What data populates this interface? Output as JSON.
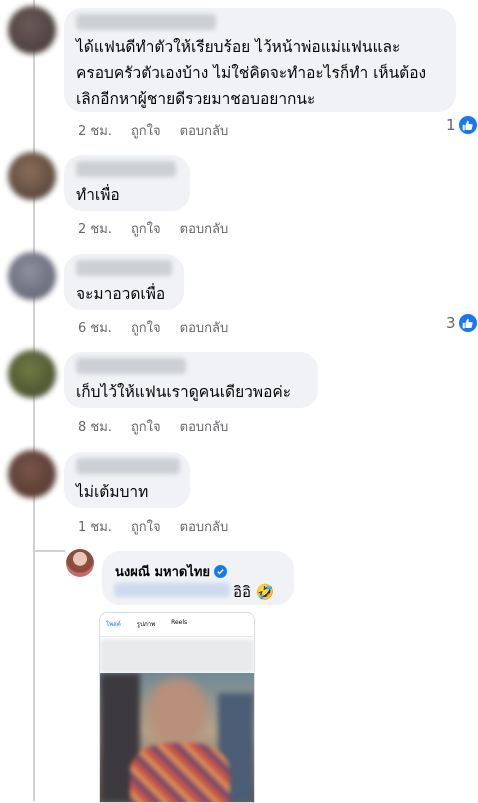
{
  "comments": [
    {
      "text": "ได้แฟนดีทำตัวให้เรียบร้อย ไว้หน้าพ่อแม่แฟนและ\nครอบครัวตัวเองบ้าง ไม่ใช่คิดจะทำอะไรก็ทำ เห็นต้อง\nเลิกอีกหาผู้ชายดีรวยมาชอบอยากนะ",
      "time": "2 ชม.",
      "like": "ถูกใจ",
      "reply": "ตอบกลับ",
      "reactions": "1"
    },
    {
      "text": "ทำเพื่อ",
      "time": "2 ชม.",
      "like": "ถูกใจ",
      "reply": "ตอบกลับ"
    },
    {
      "text": "จะมาอวดเพื่อ",
      "time": "6 ชม.",
      "like": "ถูกใจ",
      "reply": "ตอบกลับ",
      "reactions": "3"
    },
    {
      "text": "เก็บไว้ให้แฟนเราดูคนเดียวพอค่ะ",
      "time": "8 ชม.",
      "like": "ถูกใจ",
      "reply": "ตอบกลับ"
    },
    {
      "text": "ไม่เต้มบาท",
      "time": "1 ชม.",
      "like": "ถูกใจ",
      "reply": "ตอบกลับ"
    }
  ],
  "reply": {
    "author": "นงผณี มหาดไทย",
    "text": "อิอิ",
    "emoji": "🤣",
    "attachment": {
      "tab1": "โพสต์",
      "tab2": "รูปภาพ",
      "tab3": "Reels"
    }
  },
  "colors": {
    "link": "#1877f2",
    "meta": "#65676b",
    "bubble": "#f0f2f5"
  },
  "icons": {
    "like": "thumbs-up-icon",
    "verified": "verified-badge-icon"
  }
}
